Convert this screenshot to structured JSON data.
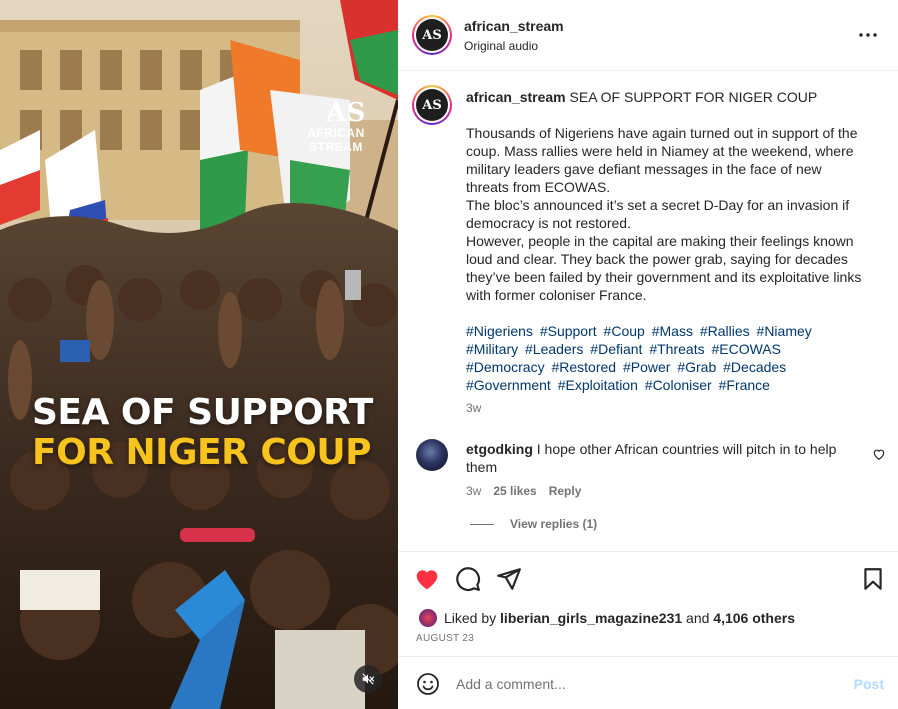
{
  "media": {
    "watermark_logo": "AS",
    "watermark_line1": "AFRICAN",
    "watermark_line2": "STREAM",
    "overlay_line1": "SEA OF SUPPORT",
    "overlay_line2": "FOR NIGER COUP",
    "mute_icon": "speaker-muted-icon"
  },
  "header": {
    "username": "african_stream",
    "subtitle": "Original audio",
    "more_icon": "more-options-icon"
  },
  "caption": {
    "username": "african_stream",
    "headline": "SEA OF SUPPORT FOR NIGER COUP",
    "paragraphs": [
      "Thousands of Nigeriens have again turned out in support of the coup. Mass rallies were held in Niamey at the weekend, where military leaders gave defiant messages in the face of new threats from ECOWAS.",
      "The bloc’s announced it’s set a secret D-Day for an invasion if democracy is not restored.",
      "However, people in the capital are making their feelings known loud and clear. They back the power grab, saying for decades they’ve been failed by their government and its exploitative links with former coloniser France."
    ],
    "hashtags": [
      "#Nigeriens",
      "#Support",
      "#Coup",
      "#Mass",
      "#Rallies",
      "#Niamey",
      "#Military",
      "#Leaders",
      "#Defiant",
      "#Threats",
      "#ECOWAS",
      "#Democracy",
      "#Restored",
      "#Power",
      "#Grab",
      "#Decades",
      "#Government",
      "#Exploitation",
      "#Coloniser",
      "#France"
    ],
    "time": "3w"
  },
  "comment": {
    "username": "etgodking",
    "text": "I hope other African countries will pitch in to help them",
    "time": "3w",
    "likes": "25 likes",
    "reply": "Reply",
    "view_replies": "View replies (1)"
  },
  "actions": {
    "liked_prefix": "Liked by",
    "liked_user": "liberian_girls_magazine231",
    "liked_and": "and",
    "liked_others": "4,106 others",
    "date": "AUGUST 23",
    "like_color": "#ff3040"
  },
  "add_comment": {
    "placeholder": "Add a comment...",
    "post_label": "Post"
  }
}
